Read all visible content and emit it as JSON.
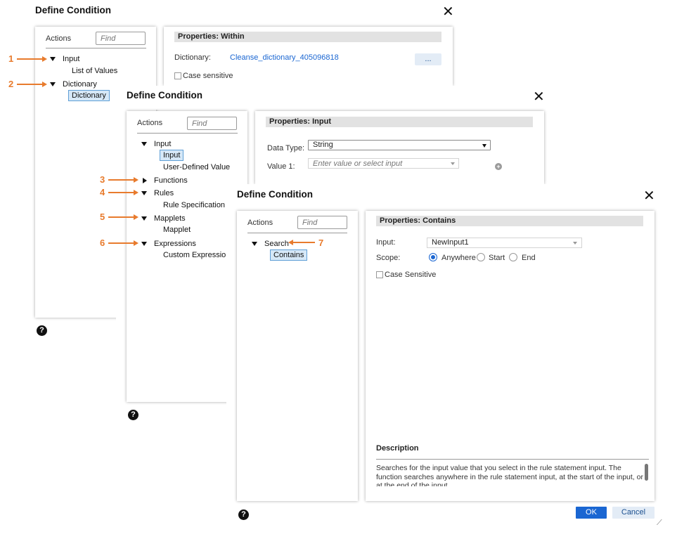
{
  "dialog1": {
    "title": "Define Condition",
    "close": "✕",
    "actions_label": "Actions",
    "find_placeholder": "Find",
    "tree": {
      "input": "Input",
      "list_of_values": "List of Values",
      "dictionary": "Dictionary",
      "dictionary_child": "Dictionary"
    },
    "props_header": "Properties: Within",
    "dictionary_label": "Dictionary:",
    "dictionary_value": "Cleanse_dictionary_405096818",
    "browse_button": "...",
    "case_sensitive": "Case sensitive",
    "help": "?"
  },
  "dialog2": {
    "title": "Define Condition",
    "close": "✕",
    "actions_label": "Actions",
    "find_placeholder": "Find",
    "tree": {
      "input": "Input",
      "input_child": "Input",
      "user_defined_value": "User-Defined Value",
      "functions": "Functions",
      "rules": "Rules",
      "rule_specification": "Rule Specification",
      "mapplets": "Mapplets",
      "mapplet": "Mapplet",
      "expressions": "Expressions",
      "custom_expression": "Custom Expression"
    },
    "props_header": "Properties: Input",
    "data_type_label": "Data Type:",
    "data_type_value": "String",
    "value1_label": "Value 1:",
    "value1_placeholder": "Enter value or select input",
    "add": "+",
    "help": "?"
  },
  "dialog3": {
    "title": "Define Condition",
    "close": "✕",
    "actions_label": "Actions",
    "find_placeholder": "Find",
    "tree": {
      "search": "Search",
      "contains": "Contains"
    },
    "props_header": "Properties: Contains",
    "input_label": "Input:",
    "input_value": "NewInput1",
    "scope_label": "Scope:",
    "scope_options": [
      "Anywhere",
      "Start",
      "End"
    ],
    "scope_selected": "Anywhere",
    "case_sensitive": "Case Sensitive",
    "description_heading": "Description",
    "description_text": "Searches for the input value that you select in the rule statement input. The function searches anywhere in the rule statement input, at the start of the input, or at the end of the input.",
    "ok": "OK",
    "cancel": "Cancel",
    "help": "?"
  },
  "callouts": [
    "1",
    "2",
    "3",
    "4",
    "5",
    "6",
    "7"
  ],
  "colors": {
    "callout": "#e87b2d",
    "primary": "#1a66d2",
    "selection_bg": "#d6e8f7",
    "header_bg": "#e2e2e2"
  }
}
